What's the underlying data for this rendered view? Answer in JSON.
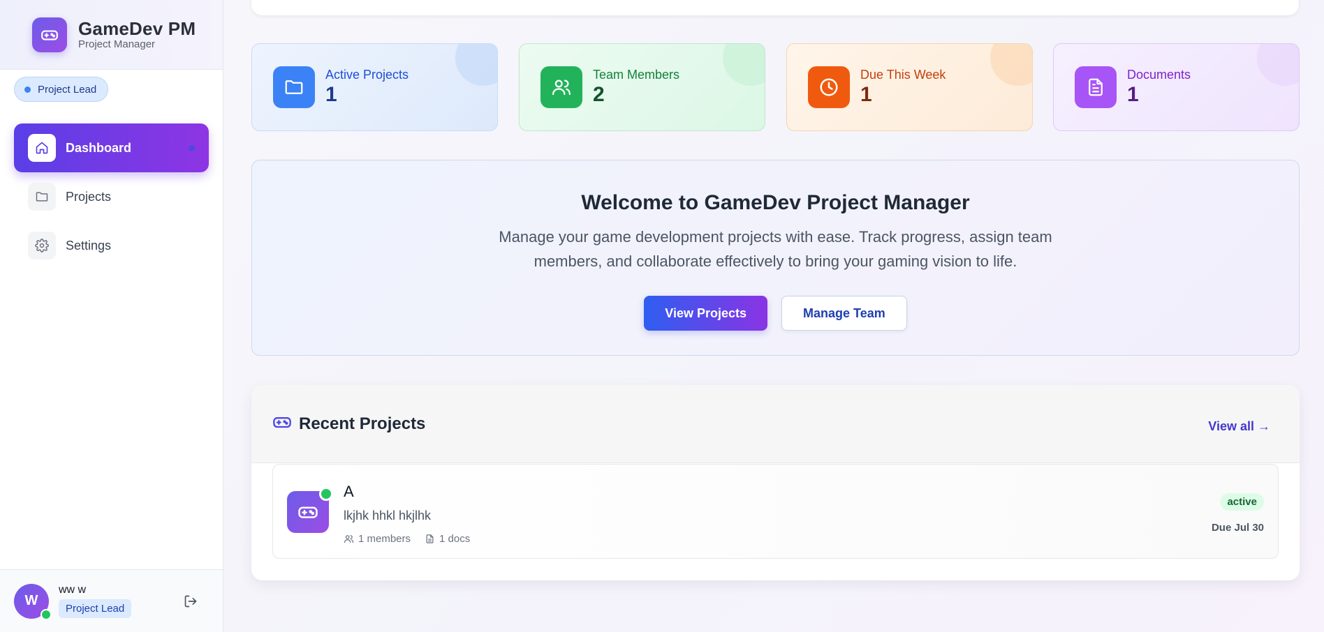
{
  "brand": {
    "title": "GameDev PM",
    "subtitle": "Project Manager"
  },
  "role_badge": "Project Lead",
  "nav": {
    "items": [
      {
        "label": "Dashboard",
        "icon": "home-icon",
        "active": true
      },
      {
        "label": "Projects",
        "icon": "folder-icon",
        "active": false
      },
      {
        "label": "Settings",
        "icon": "gear-icon",
        "active": false
      }
    ]
  },
  "user": {
    "initial": "W",
    "name": "ww w",
    "role": "Project Lead"
  },
  "stats": [
    {
      "label": "Active Projects",
      "value": "1",
      "icon": "folder-icon",
      "color": "#3b82f6"
    },
    {
      "label": "Team Members",
      "value": "2",
      "icon": "users-icon",
      "color": "#22b35a"
    },
    {
      "label": "Due This Week",
      "value": "1",
      "icon": "clock-icon",
      "color": "#ef5a0f"
    },
    {
      "label": "Documents",
      "value": "1",
      "icon": "document-icon",
      "color": "#a855f7"
    }
  ],
  "welcome": {
    "title": "Welcome to GameDev Project Manager",
    "text": "Manage your game development projects with ease. Track progress, assign team members, and collaborate effectively to bring your gaming vision to life.",
    "primary_button": "View Projects",
    "secondary_button": "Manage Team"
  },
  "recent": {
    "title": "Recent Projects",
    "view_all": "View all →",
    "projects": [
      {
        "name": "A",
        "description": "lkjhk hhkl hkjlhk",
        "members": "1 members",
        "docs": "1 docs",
        "status": "active",
        "due": "Due Jul 30"
      }
    ]
  }
}
